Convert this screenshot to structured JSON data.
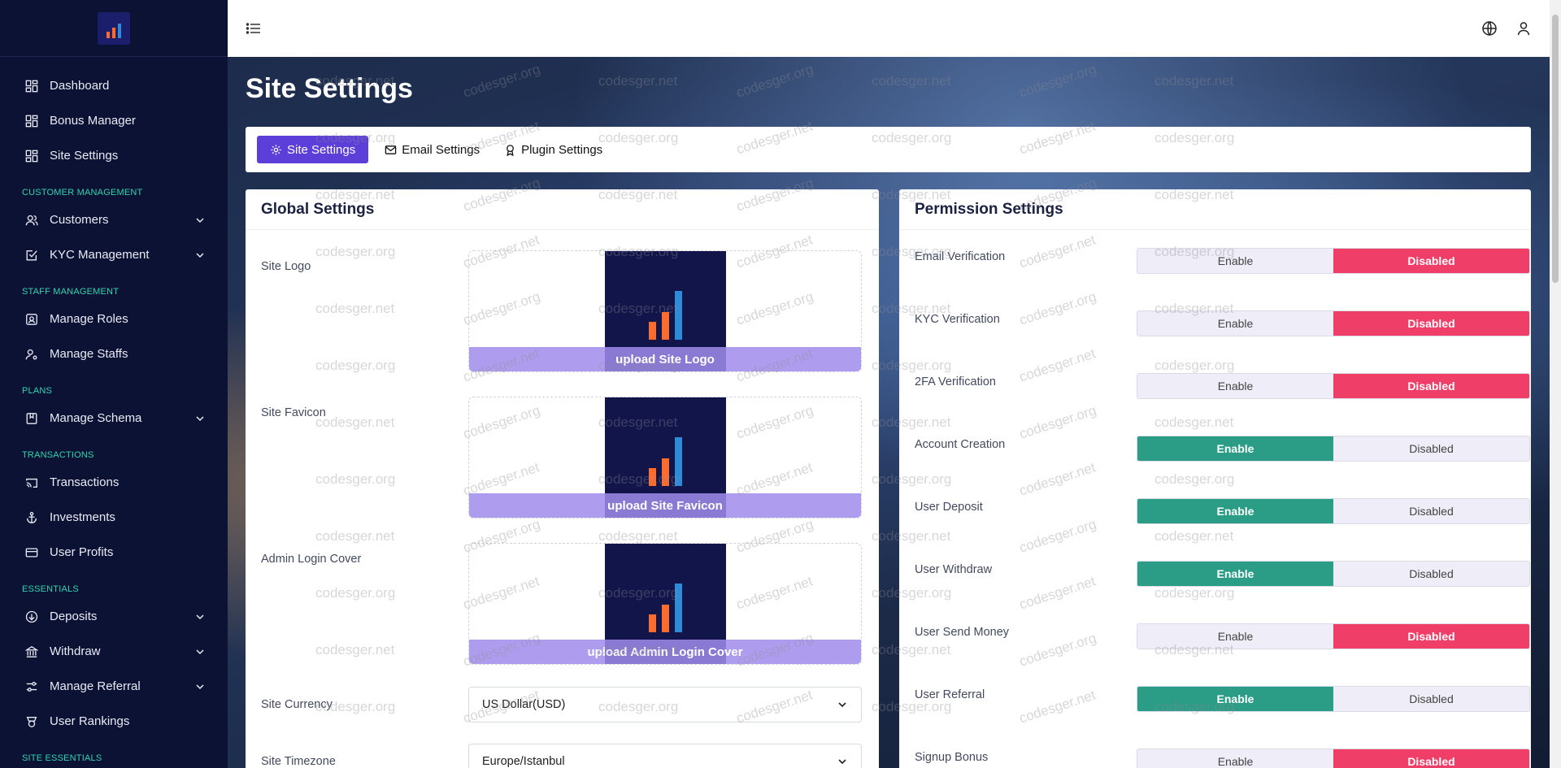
{
  "sidebar": {
    "items": [
      {
        "label": "Dashboard",
        "icon": "dashboard-icon"
      },
      {
        "label": "Bonus Manager",
        "icon": "dashboard-icon"
      },
      {
        "label": "Site Settings",
        "icon": "dashboard-icon"
      }
    ],
    "sections": [
      {
        "title": "CUSTOMER MANAGEMENT",
        "items": [
          {
            "label": "Customers",
            "icon": "users-icon",
            "expandable": true
          },
          {
            "label": "KYC Management",
            "icon": "checklist-icon",
            "expandable": true
          }
        ]
      },
      {
        "title": "STAFF MANAGEMENT",
        "items": [
          {
            "label": "Manage Roles",
            "icon": "id-card-icon"
          },
          {
            "label": "Manage Staffs",
            "icon": "user-gear-icon"
          }
        ]
      },
      {
        "title": "PLANS",
        "items": [
          {
            "label": "Manage Schema",
            "icon": "book-icon",
            "expandable": true
          }
        ]
      },
      {
        "title": "TRANSACTIONS",
        "items": [
          {
            "label": "Transactions",
            "icon": "cast-icon"
          },
          {
            "label": "Investments",
            "icon": "anchor-icon"
          },
          {
            "label": "User Profits",
            "icon": "credit-card-icon"
          }
        ]
      },
      {
        "title": "ESSENTIALS",
        "items": [
          {
            "label": "Deposits",
            "icon": "arrow-circle-icon",
            "expandable": true
          },
          {
            "label": "Withdraw",
            "icon": "bank-icon",
            "expandable": true
          },
          {
            "label": "Manage Referral",
            "icon": "sliders-icon",
            "expandable": true
          },
          {
            "label": "User Rankings",
            "icon": "award-icon"
          }
        ]
      },
      {
        "title": "SITE ESSENTIALS",
        "items": []
      }
    ]
  },
  "page": {
    "title": "Site Settings"
  },
  "tabs": [
    {
      "label": "Site Settings",
      "icon": "gear-icon",
      "active": true
    },
    {
      "label": "Email Settings",
      "icon": "mail-icon",
      "active": false
    },
    {
      "label": "Plugin Settings",
      "icon": "ribbon-icon",
      "active": false
    }
  ],
  "global": {
    "title": "Global Settings",
    "logo_label": "Site Logo",
    "logo_caption": "upload Site Logo",
    "favicon_label": "Site Favicon",
    "favicon_caption": "upload Site Favicon",
    "cover_label": "Admin Login Cover",
    "cover_caption": "upload Admin Login Cover",
    "currency_label": "Site Currency",
    "currency_value": "US Dollar(USD)",
    "timezone_label": "Site Timezone",
    "timezone_value": "Europe/Istanbul"
  },
  "permission": {
    "title": "Permission Settings",
    "enable_label": "Enable",
    "disabled_label": "Disabled",
    "rows": [
      {
        "label": "Email Verification",
        "state": "disabled"
      },
      {
        "label": "KYC Verification",
        "state": "disabled"
      },
      {
        "label": "2FA Verification",
        "state": "disabled"
      },
      {
        "label": "Account Creation",
        "state": "enable"
      },
      {
        "label": "User Deposit",
        "state": "enable"
      },
      {
        "label": "User Withdraw",
        "state": "enable"
      },
      {
        "label": "User Send Money",
        "state": "disabled"
      },
      {
        "label": "User Referral",
        "state": "enable"
      },
      {
        "label": "Signup Bonus",
        "state": "disabled"
      }
    ]
  },
  "watermarks": [
    "codesger.net",
    "codesger.org"
  ],
  "colors": {
    "primary": "#5b3fd8",
    "enable": "#2b9c85",
    "disabled": "#ef3f68",
    "sidebar": "#0c1233",
    "section": "#2fd4b0"
  }
}
